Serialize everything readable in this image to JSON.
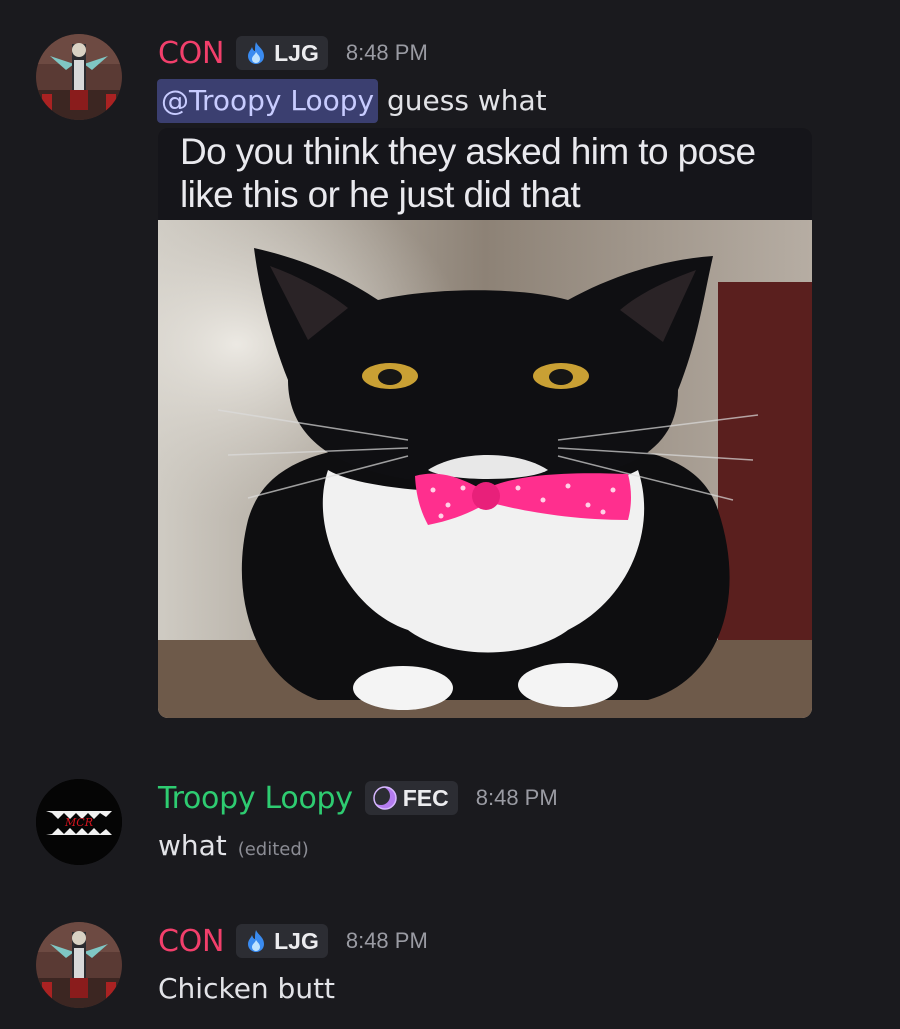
{
  "messages": [
    {
      "username": "CON",
      "username_color": "#f23f6b",
      "tag": "LJG",
      "tag_icon": "blue-flame-icon",
      "timestamp": "8:48 PM",
      "mention": "@Troopy Loopy",
      "text": "guess what",
      "attachment": {
        "caption_line1": "Do you think they asked him to pose",
        "caption_line2": "like this or he just did that"
      }
    },
    {
      "username": "Troopy Loopy",
      "username_color": "#2ecc71",
      "tag": "FEC",
      "tag_icon": "purple-moon-icon",
      "timestamp": "8:48 PM",
      "text": "what",
      "edited": "(edited)",
      "avatar_text": "My Chemical Romance"
    },
    {
      "username": "CON",
      "username_color": "#f23f6b",
      "tag": "LJG",
      "tag_icon": "blue-flame-icon",
      "timestamp": "8:48 PM",
      "text": "Chicken butt"
    }
  ]
}
